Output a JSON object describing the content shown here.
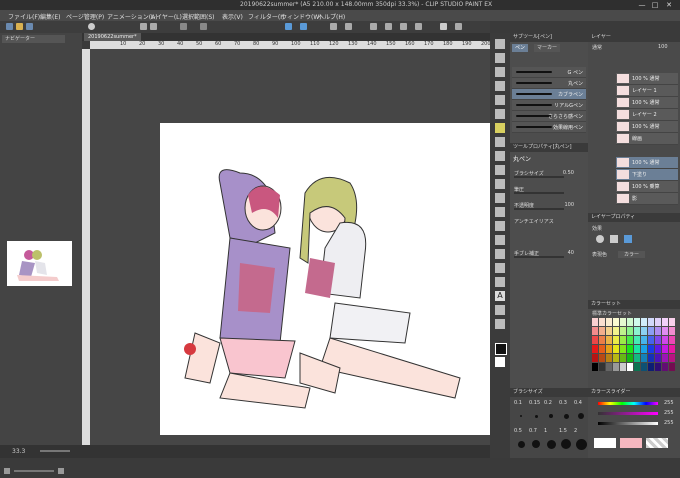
{
  "title_bar": {
    "title": "20190622summer* (A5 210.00 x 148.00mm 350dpi 33.3%) - CLIP STUDIO PAINT EX",
    "minimize": "—",
    "maximize": "□",
    "close": "✕"
  },
  "menu": [
    "ファイル(F)",
    "編集(E)",
    "ページ管理(P)",
    "アニメーション(A)",
    "レイヤー(L)",
    "選択範囲(S)",
    "表示(V)",
    "フィルター(I)",
    "ウィンドウ(W)",
    "ヘルプ(H)"
  ],
  "navigator": {
    "tab": "ナビゲーター",
    "zoom_value": "33.3"
  },
  "canvas": {
    "tab": "20190622summer*",
    "ruler_ticks": [
      "10",
      "20",
      "30",
      "40",
      "50",
      "60",
      "70",
      "80",
      "90",
      "100",
      "110",
      "120",
      "130",
      "140",
      "150",
      "160",
      "170",
      "180",
      "190",
      "200"
    ]
  },
  "subtool": {
    "header": "サブツール[ペン]",
    "tabs": [
      "ペン",
      "マーカー"
    ],
    "brushes": [
      "G ペン",
      "丸ペン",
      "カブラペン",
      "リアルGペン",
      "さらさら感ペン",
      "効果線用ペン"
    ],
    "selected_index": 2
  },
  "tool_property": {
    "header": "ツールプロパティ[丸ペン]",
    "name": "丸ペン",
    "rows": [
      {
        "label": "ブラシサイズ",
        "value": "0.50"
      },
      {
        "label": "筆圧",
        "value": ""
      },
      {
        "label": "不透明度",
        "value": "100"
      },
      {
        "label": "アンチエイリアス",
        "value": ""
      },
      {
        "label": "手ブレ補正",
        "value": "40"
      }
    ]
  },
  "layers": {
    "header": "レイヤー",
    "mode": "通常",
    "opacity": "100",
    "items": [
      {
        "name": "100 % 通常"
      },
      {
        "name": "レイヤー 1"
      },
      {
        "name": "100 % 通常"
      },
      {
        "name": "レイヤー 2"
      },
      {
        "name": "100 % 通常"
      },
      {
        "name": "線画"
      },
      {
        "name": "100 % 通常"
      },
      {
        "name": "下塗り"
      },
      {
        "name": "100 % 乗算"
      },
      {
        "name": "影"
      }
    ]
  },
  "layer_property": {
    "header": "レイヤープロパティ",
    "effect_label": "効果",
    "expression_label": "表現色",
    "expression_value": "カラー"
  },
  "colorset": {
    "header": "カラーセット",
    "set_name": "標準カラーセット"
  },
  "color_slider": {
    "header": "カラースライダー",
    "values": [
      "255",
      "255",
      "255"
    ]
  },
  "brush_size": {
    "header": "ブラシサイズ",
    "sizes": [
      "0.1",
      "0.15",
      "0.2",
      "0.3",
      "0.4",
      "0.5",
      "0.7",
      "1",
      "1.5",
      "2"
    ]
  },
  "colors": {
    "accent": "#6b7f96",
    "paper": "#ffffff",
    "background": "#3a3a3a"
  }
}
